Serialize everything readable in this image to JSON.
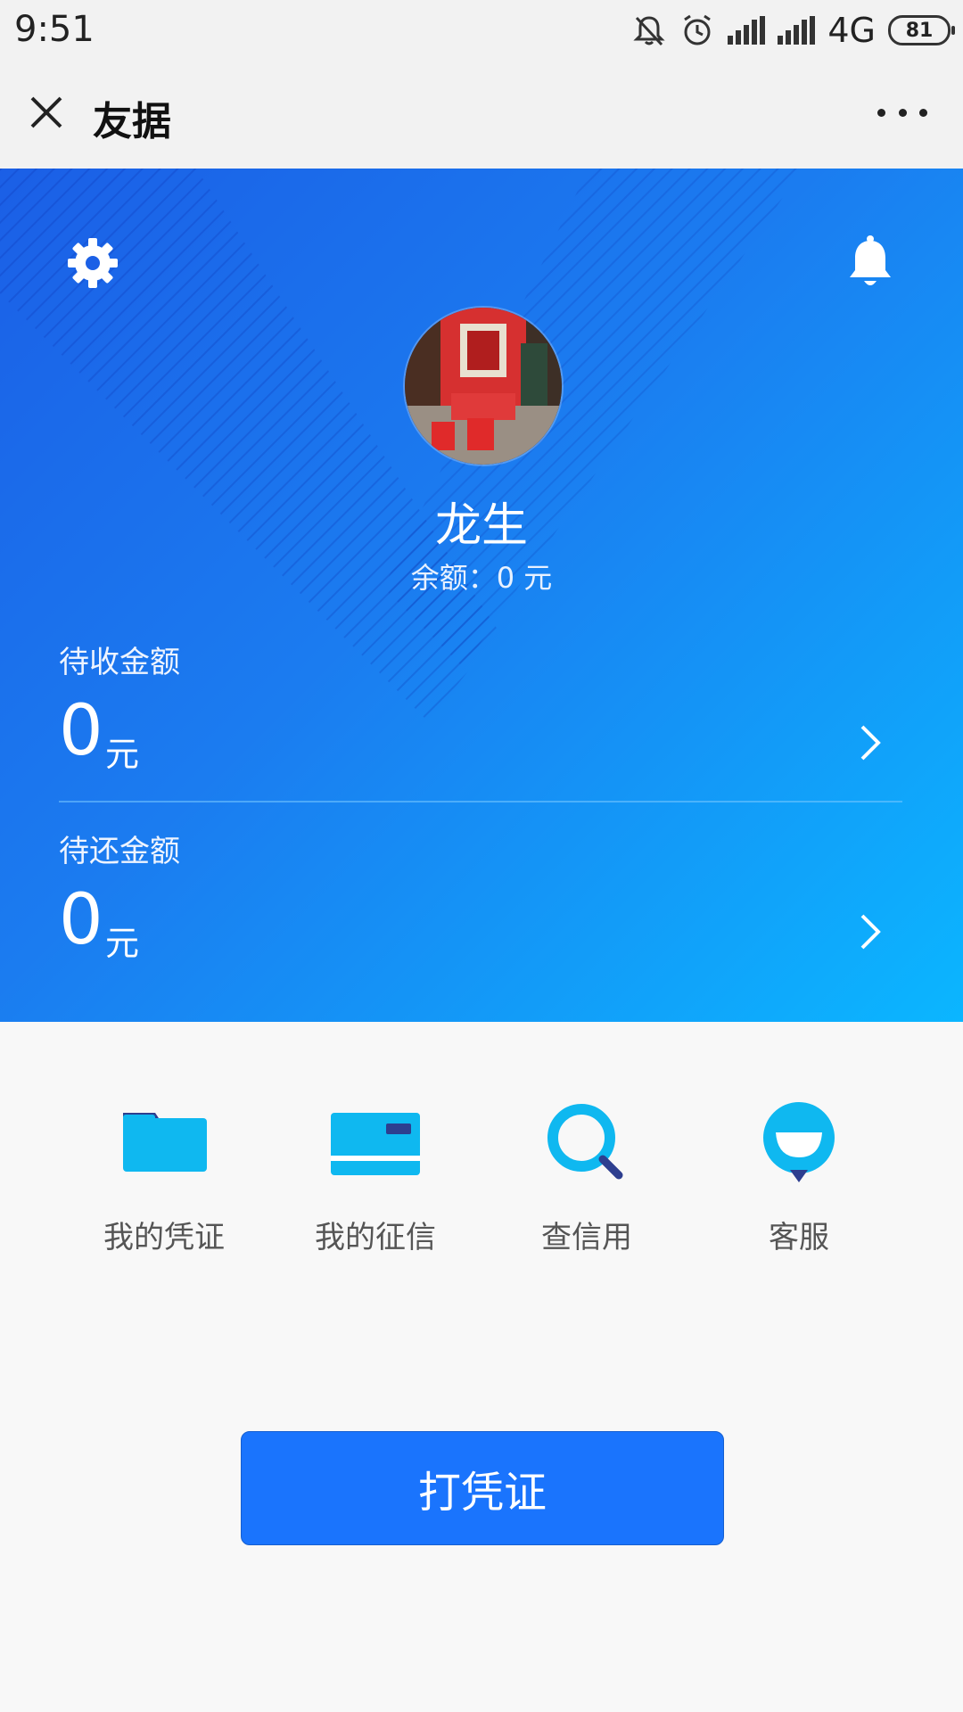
{
  "status_bar": {
    "time": "9:51",
    "network": "4G",
    "battery": "81"
  },
  "title_bar": {
    "title": "友据"
  },
  "profile": {
    "name": "龙生",
    "balance": "余额：0 元"
  },
  "amounts": [
    {
      "label": "待收金额",
      "value": "0",
      "unit": "元"
    },
    {
      "label": "待还金额",
      "value": "0",
      "unit": "元"
    }
  ],
  "actions": [
    {
      "label": "我的凭证",
      "icon": "folder-icon"
    },
    {
      "label": "我的征信",
      "icon": "card-icon"
    },
    {
      "label": "查信用",
      "icon": "magnifier-icon"
    },
    {
      "label": "客服",
      "icon": "customer-service-icon"
    }
  ],
  "primary_button": {
    "label": "打凭证"
  },
  "colors": {
    "accent": "#1a74fd",
    "hero_start": "#1b5fe6",
    "hero_end": "#0bb6ff",
    "icon_light": "#0fb8f0",
    "icon_dark": "#2d3e8f"
  }
}
